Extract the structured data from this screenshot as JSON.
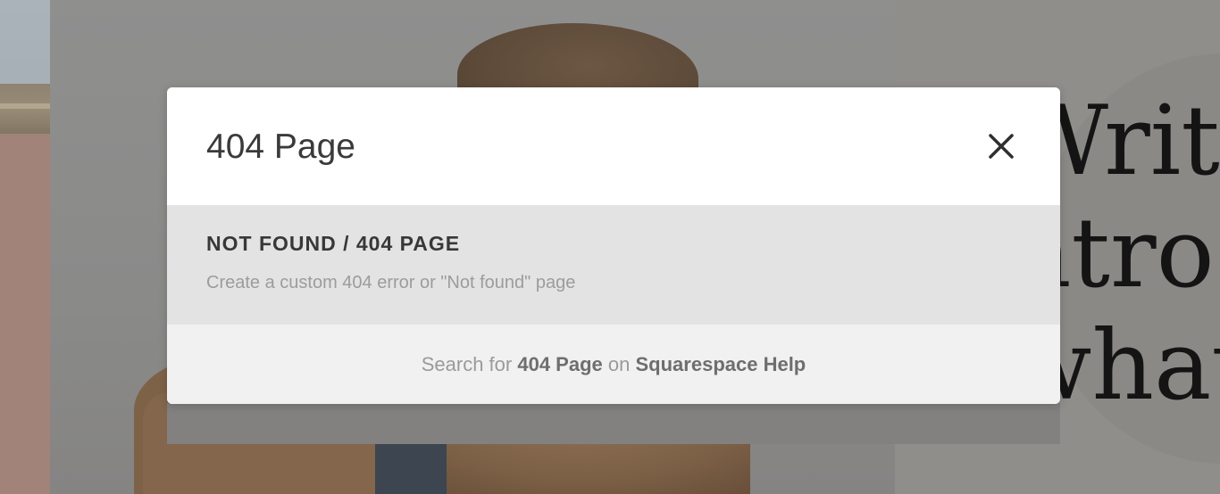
{
  "background": {
    "heading_lines": "Write\nntro\nwhat"
  },
  "dialog": {
    "title": "404 Page",
    "close_icon": "close-icon",
    "result": {
      "title": "NOT FOUND / 404 PAGE",
      "description": "Create a custom 404 error or \"Not found\" page"
    },
    "help": {
      "prefix": "Search for",
      "query": "404 Page",
      "middle": "on",
      "site": "Squarespace Help"
    }
  }
}
